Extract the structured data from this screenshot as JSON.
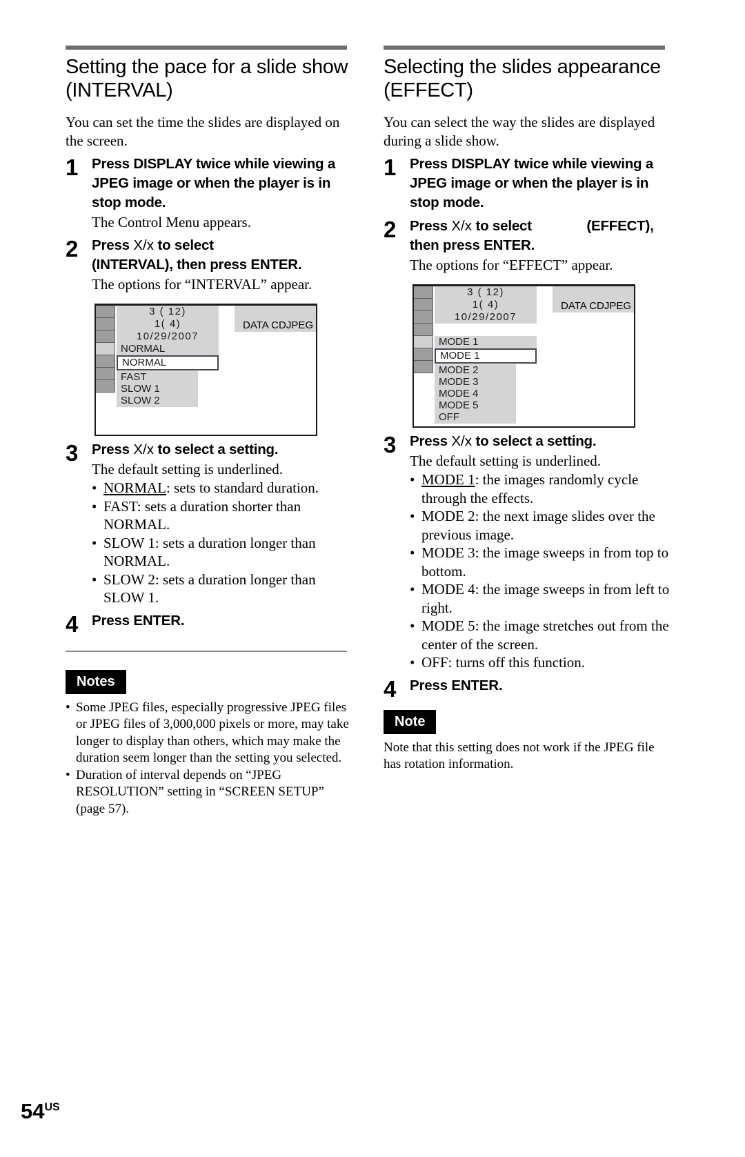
{
  "page": {
    "number": "54",
    "region": "US"
  },
  "left": {
    "heading_line1": "Setting the pace for a slide show",
    "heading_line2": "(INTERVAL)",
    "lead": "You can set the time the slides are displayed on the screen.",
    "steps": [
      {
        "num": "1",
        "title": "Press DISPLAY twice while viewing a JPEG image or when the player is in stop mode.",
        "sub": "The Control Menu appears."
      },
      {
        "num": "2",
        "title_pre": "Press ",
        "title_keys": "X/x",
        "title_mid": " to select",
        "title_post": "(INTERVAL), then press ENTER.",
        "sub": "The options for “INTERVAL” appear."
      },
      {
        "num": "3",
        "title_pre": "Press ",
        "title_keys": "X/x",
        "title_mid": " to select a setting.",
        "sub": "The default setting is underlined."
      },
      {
        "num": "4",
        "title": "Press ENTER."
      }
    ],
    "settings": [
      {
        "name": "NORMAL",
        "underlined": true,
        "desc": ": sets to standard duration."
      },
      {
        "name": "FAST",
        "underlined": false,
        "desc": ": sets a duration shorter than NORMAL."
      },
      {
        "name": "SLOW 1",
        "underlined": false,
        "desc": ": sets a duration longer than NORMAL."
      },
      {
        "name": "SLOW 2",
        "underlined": false,
        "desc": ": sets a duration longer than SLOW 1."
      }
    ],
    "screen": {
      "line1": "3 (  12)",
      "line2": "1(      4)",
      "line3": "10/29/2007",
      "badge_text": "DATA CD",
      "badge_jpeg": "JPEG",
      "current": "NORMAL",
      "options": [
        "NORMAL",
        "FAST",
        "SLOW 1",
        "SLOW 2"
      ]
    },
    "notes_tag": "Notes",
    "notes": [
      "Some JPEG files, especially progressive JPEG files or JPEG files of 3,000,000 pixels or more, may take longer to display than others, which may make the duration seem longer than the setting you selected.",
      "Duration of interval depends on “JPEG RESOLUTION” setting in “SCREEN SETUP” (page 57)."
    ]
  },
  "right": {
    "heading_line1": "Selecting the slides  appearance",
    "heading_line2": "(EFFECT)",
    "lead": "You can select the way the slides are displayed during a slide show.",
    "steps": [
      {
        "num": "1",
        "title": "Press DISPLAY twice while viewing a JPEG image or when the player is in stop mode."
      },
      {
        "num": "2",
        "title_pre": "Press ",
        "title_keys": "X/x",
        "title_mid": " to select",
        "title_tail": "(EFFECT),",
        "title_post": "then press ENTER.",
        "sub": "The options for “EFFECT” appear."
      },
      {
        "num": "3",
        "title_pre": "Press ",
        "title_keys": "X/x",
        "title_mid": " to select a setting.",
        "sub": "The default setting is underlined."
      },
      {
        "num": "4",
        "title": "Press ENTER."
      }
    ],
    "settings": [
      {
        "name": "MODE 1",
        "underlined": true,
        "desc": ": the images randomly cycle through the effects."
      },
      {
        "name": "MODE 2",
        "underlined": false,
        "desc": ": the next image slides over the previous image."
      },
      {
        "name": "MODE 3",
        "underlined": false,
        "desc": ": the image sweeps in from top to bottom."
      },
      {
        "name": "MODE 4",
        "underlined": false,
        "desc": ": the image sweeps in from left to right."
      },
      {
        "name": "MODE 5",
        "underlined": false,
        "desc": ": the image stretches out from the center of the screen."
      },
      {
        "name": "OFF",
        "underlined": false,
        "desc": ": turns off this function."
      }
    ],
    "screen": {
      "line1": "3 (  12)",
      "line2": "1(      4)",
      "line3": "10/29/2007",
      "badge_text": "DATA CD",
      "badge_jpeg": "JPEG",
      "current": "MODE 1",
      "options": [
        "MODE 1",
        "MODE 2",
        "MODE 3",
        "MODE 4",
        "MODE 5",
        "OFF"
      ]
    },
    "note_tag": "Note",
    "note": "Note that this setting does not work if the JPEG file has rotation information."
  }
}
